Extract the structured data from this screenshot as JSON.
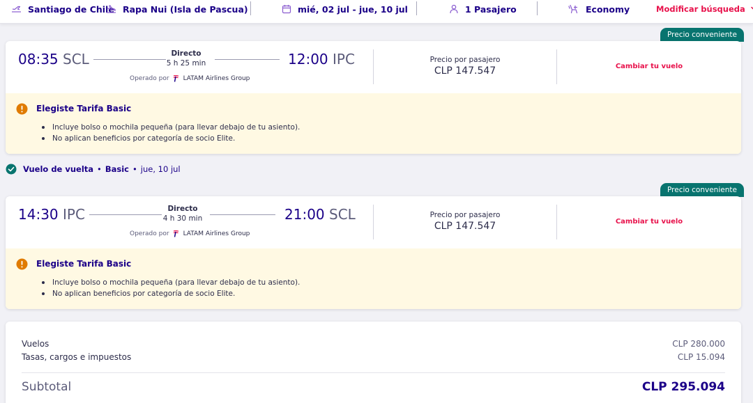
{
  "search": {
    "origin": "Santiago de Chile",
    "destination": "Rapa Nui (Isla de Pascua)",
    "dates": "mié, 02 jul - jue, 10 jul",
    "passengers": "1 Pasajero",
    "cabin": "Economy",
    "modify_label": "Modificar búsqueda"
  },
  "outbound": {
    "badge": "Precio conveniente",
    "departure_time": "08:35",
    "departure_code": "SCL",
    "arrival_time": "12:00",
    "arrival_code": "IPC",
    "type": "Directo",
    "duration": "5 h 25 min",
    "operated_by_label": "Operado por",
    "airline": "LATAM Airlines Group",
    "price_label": "Precio por pasajero",
    "price": "CLP 147.547",
    "change_label": "Cambiar tu vuelo",
    "fare_title": "Elegiste Tarifa Basic",
    "fare_items": [
      "Incluye bolso o mochila pequeña (para llevar debajo de tu asiento).",
      "No aplican beneficios por categoría de socio Elite."
    ]
  },
  "return_label": {
    "segment": "Vuelo de vuelta",
    "separator": "•",
    "fare": "Basic",
    "date": "jue, 10 jul"
  },
  "inbound": {
    "badge": "Precio conveniente",
    "departure_time": "14:30",
    "departure_code": "IPC",
    "arrival_time": "21:00",
    "arrival_code": "SCL",
    "type": "Directo",
    "duration": "4 h 30 min",
    "operated_by_label": "Operado por",
    "airline": "LATAM Airlines Group",
    "price_label": "Precio por pasajero",
    "price": "CLP 147.547",
    "change_label": "Cambiar tu vuelo",
    "fare_title": "Elegiste Tarifa Basic",
    "fare_items": [
      "Incluye bolso o mochila pequeña (para llevar debajo de tu asiento).",
      "No aplican beneficios por categoría de socio Elite."
    ]
  },
  "summary": {
    "flights_label": "Vuelos",
    "flights_amount": "CLP 280.000",
    "taxes_label": "Tasas, cargos e impuestos",
    "taxes_amount": "CLP 15.094",
    "subtotal_label": "Subtotal",
    "subtotal_amount": "CLP 295.094"
  },
  "icons": {
    "origin": "plane-takeoff-icon",
    "destination": "plane-landing-icon",
    "dates": "calendar-icon",
    "passengers": "person-icon",
    "cabin": "seat-icon",
    "modify": "chevron-down-icon",
    "fare_warning": "warning-icon",
    "return_check": "check-circle-icon",
    "airline_logo": "latam-logo-icon"
  },
  "colors": {
    "brand": "#1b0088",
    "accent": "#e8114b",
    "badge": "#08746f",
    "fare_background": "#fff9e3",
    "warning": "#e07b00",
    "check": "#08746f"
  }
}
